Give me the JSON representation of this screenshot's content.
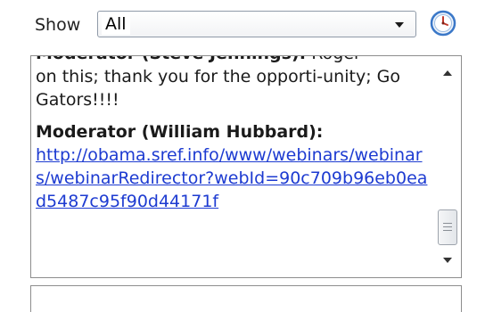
{
  "filter": {
    "label": "Show",
    "selected": "All"
  },
  "chat": {
    "partial_sender": "Moderator (Steve Jennings):",
    "partial_text_first": " Roger",
    "partial_text_rest": "on this; thank you for the opporti-unity; Go Gators!!!!",
    "sender": "Moderator (William Hubbard):",
    "link": "http://obama.sref.info/www/webinars/webinars/webinarRedirector?webId=90c709b96eb0ead5487c95f90d44171f"
  },
  "icons": {
    "history": "clock-icon",
    "dropdown": "chevron-down-icon",
    "scroll_up": "arrow-up-icon",
    "scroll_down": "arrow-down-icon"
  },
  "colors": {
    "link": "#1d3bd1",
    "clock_accent": "#3b78c8"
  }
}
